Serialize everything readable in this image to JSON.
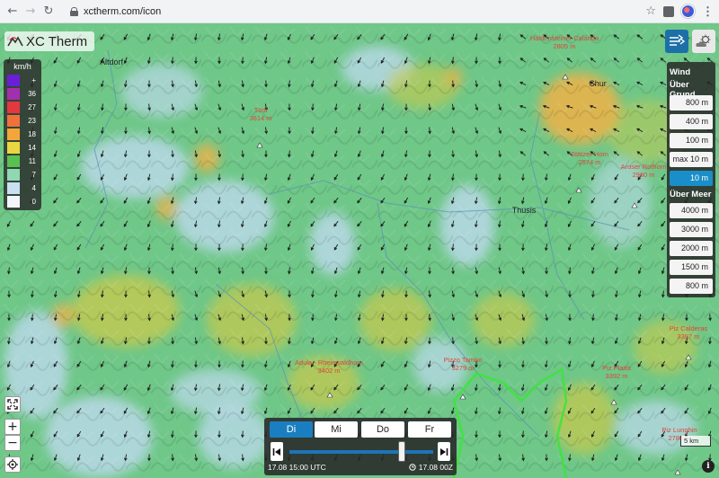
{
  "browser": {
    "url": "xctherm.com/icon"
  },
  "app": {
    "title": "XC Therm"
  },
  "legend": {
    "unit": "km/h",
    "entries": [
      {
        "label": "+",
        "color": "#6a1fd6"
      },
      {
        "label": "36",
        "color": "#a32fb0"
      },
      {
        "label": "27",
        "color": "#e2383e"
      },
      {
        "label": "23",
        "color": "#f0713a"
      },
      {
        "label": "18",
        "color": "#f4a63a"
      },
      {
        "label": "14",
        "color": "#e8d642"
      },
      {
        "label": "11",
        "color": "#59c150"
      },
      {
        "label": "7",
        "color": "#8fd8b2"
      },
      {
        "label": "4",
        "color": "#c9dff2"
      },
      {
        "label": "0",
        "color": "#f2f6fb"
      }
    ]
  },
  "layers": {
    "wind_icon": "wind-arrows-icon",
    "cloud_icon": "sun-cloud-icon",
    "active": "wind"
  },
  "panel": {
    "title": "Wind",
    "above_ground_label": "Über Grund",
    "above_ground": [
      "800 m",
      "400 m",
      "100 m",
      "max 10 m",
      "10 m"
    ],
    "above_sea_label": "Über Meer",
    "above_sea": [
      "4000 m",
      "3000 m",
      "2000 m",
      "1500 m",
      "800 m"
    ],
    "selected": "10 m"
  },
  "places": [
    {
      "name": "Altdorf",
      "elev": ""
    },
    {
      "name": "Haldensteiner Calanda",
      "elev": "2805 m"
    },
    {
      "name": "Chur",
      "elev": ""
    },
    {
      "name": "Tödi",
      "elev": "3614 m"
    },
    {
      "name": "Stätzer Horn",
      "elev": "2574 m"
    },
    {
      "name": "Aroser Rothorn",
      "elev": "2980 m"
    },
    {
      "name": "Thusis",
      "elev": ""
    },
    {
      "name": "Adula - Rheinwaldhorn",
      "elev": "3402 m"
    },
    {
      "name": "Pizzo Tambo",
      "elev": "3279 m"
    },
    {
      "name": "Piz Platta",
      "elev": "3392 m"
    },
    {
      "name": "Piz Calderas",
      "elev": "3397 m"
    },
    {
      "name": "Piz Lunghin",
      "elev": "2780 m"
    }
  ],
  "time": {
    "days": [
      "Di",
      "Mi",
      "Do",
      "Fr"
    ],
    "selected_day": "Di",
    "current": "17.08 15:00 UTC",
    "run": "17.08 00Z",
    "slider_position": 0.78
  },
  "controls": {
    "zoom_in": "+",
    "zoom_out": "−",
    "info": "i"
  },
  "scale": {
    "label": "5 km"
  },
  "colors": {
    "map_base": "#6fc788",
    "selected": "#1a8ec8",
    "border": "#3ce43c"
  }
}
